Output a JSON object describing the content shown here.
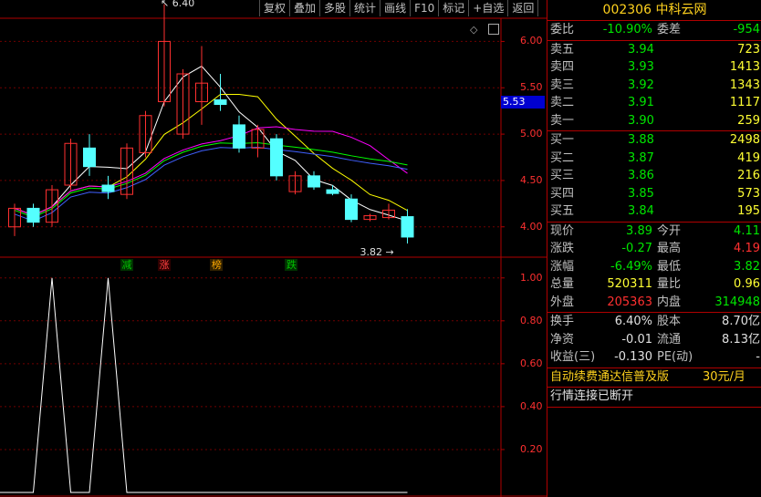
{
  "toolbar": [
    "复权",
    "叠加",
    "多股",
    "统计",
    "画线",
    "F10",
    "标记",
    "+自选",
    "返回"
  ],
  "stock": {
    "code": "002306",
    "name": "中科云网"
  },
  "price_tag": "5.53",
  "price_axis": [
    "6.00",
    "5.50",
    "5.00",
    "4.50",
    "4.00"
  ],
  "indicator_axis": [
    "1.00",
    "0.80",
    "0.60",
    "0.40",
    "0.20"
  ],
  "annotations": {
    "high": "6.40",
    "low": "3.82"
  },
  "markers": [
    {
      "text": "减",
      "color": "#00c000",
      "bg": "#003000"
    },
    {
      "text": "涨",
      "color": "#ff4040",
      "bg": "#300000"
    },
    {
      "text": "榜",
      "color": "#ffaa00",
      "bg": "#302000"
    },
    {
      "text": "跌",
      "color": "#00c000",
      "bg": "#003000"
    }
  ],
  "order_book": {
    "weibi": {
      "label": "委比",
      "value": "-10.90%",
      "label2": "委差",
      "value2": "-954"
    },
    "sell": [
      {
        "label": "卖五",
        "price": "3.94",
        "vol": "723"
      },
      {
        "label": "卖四",
        "price": "3.93",
        "vol": "1413"
      },
      {
        "label": "卖三",
        "price": "3.92",
        "vol": "1343"
      },
      {
        "label": "卖二",
        "price": "3.91",
        "vol": "1117"
      },
      {
        "label": "卖一",
        "price": "3.90",
        "vol": "259"
      }
    ],
    "buy": [
      {
        "label": "买一",
        "price": "3.88",
        "vol": "2498"
      },
      {
        "label": "买二",
        "price": "3.87",
        "vol": "419"
      },
      {
        "label": "买三",
        "price": "3.86",
        "vol": "216"
      },
      {
        "label": "买四",
        "price": "3.85",
        "vol": "573"
      },
      {
        "label": "买五",
        "price": "3.84",
        "vol": "195"
      }
    ]
  },
  "quote": [
    {
      "l1": "现价",
      "v1": "3.89",
      "l2": "今开",
      "v2": "4.11"
    },
    {
      "l1": "涨跌",
      "v1": "-0.27",
      "l2": "最高",
      "v2": "4.19"
    },
    {
      "l1": "涨幅",
      "v1": "-6.49%",
      "l2": "最低",
      "v2": "3.82"
    },
    {
      "l1": "总量",
      "v1": "520311",
      "l2": "量比",
      "v2": "0.96"
    },
    {
      "l1": "外盘",
      "v1": "205363",
      "l2": "内盘",
      "v2": "314948"
    }
  ],
  "fundamentals": [
    {
      "l1": "换手",
      "v1": "6.40%",
      "l2": "股本",
      "v2": "8.70亿"
    },
    {
      "l1": "净资",
      "v1": "-0.01",
      "l2": "流通",
      "v2": "8.13亿"
    },
    {
      "l1": "收益(三)",
      "v1": "-0.130",
      "l2": "PE(动)",
      "v2": "-"
    }
  ],
  "promo": {
    "text": "自动续费通达信普及版",
    "price": "30元/月"
  },
  "status": "行情连接已断开",
  "chart_data": {
    "type": "candlestick",
    "candles": [
      {
        "o": 4.0,
        "c": 4.2,
        "h": 4.25,
        "l": 3.9
      },
      {
        "o": 4.2,
        "c": 4.05,
        "h": 4.25,
        "l": 4.0
      },
      {
        "o": 4.05,
        "c": 4.4,
        "h": 4.45,
        "l": 4.0
      },
      {
        "o": 4.45,
        "c": 4.9,
        "h": 4.95,
        "l": 4.4
      },
      {
        "o": 4.85,
        "c": 4.65,
        "h": 5.0,
        "l": 4.55
      },
      {
        "o": 4.45,
        "c": 4.38,
        "h": 4.55,
        "l": 4.3
      },
      {
        "o": 4.35,
        "c": 4.85,
        "h": 4.9,
        "l": 4.3
      },
      {
        "o": 4.8,
        "c": 5.2,
        "h": 5.25,
        "l": 4.75
      },
      {
        "o": 5.35,
        "c": 6.0,
        "h": 6.4,
        "l": 5.3
      },
      {
        "o": 5.0,
        "c": 5.65,
        "h": 5.7,
        "l": 4.95
      },
      {
        "o": 5.35,
        "c": 5.55,
        "h": 5.95,
        "l": 5.1
      },
      {
        "o": 5.37,
        "c": 5.32,
        "h": 5.65,
        "l": 5.25
      },
      {
        "o": 5.1,
        "c": 4.85,
        "h": 5.2,
        "l": 4.8
      },
      {
        "o": 4.85,
        "c": 5.05,
        "h": 5.1,
        "l": 4.75
      },
      {
        "o": 4.95,
        "c": 4.55,
        "h": 5.0,
        "l": 4.5
      },
      {
        "o": 4.38,
        "c": 4.55,
        "h": 4.6,
        "l": 4.35
      },
      {
        "o": 4.55,
        "c": 4.43,
        "h": 4.6,
        "l": 4.4
      },
      {
        "o": 4.4,
        "c": 4.36,
        "h": 4.45,
        "l": 4.34
      },
      {
        "o": 4.3,
        "c": 4.08,
        "h": 4.35,
        "l": 4.05
      },
      {
        "o": 4.08,
        "c": 4.12,
        "h": 4.14,
        "l": 4.06
      },
      {
        "o": 4.1,
        "c": 4.18,
        "h": 4.25,
        "l": 4.08
      },
      {
        "o": 4.11,
        "c": 3.89,
        "h": 4.19,
        "l": 3.82
      }
    ],
    "ylim": [
      3.9,
      6.0
    ],
    "indicator": [
      0,
      0,
      1,
      0,
      0,
      1,
      0,
      0,
      0,
      0,
      0,
      0,
      0,
      0,
      0,
      0,
      0,
      0,
      0,
      0,
      0,
      0
    ],
    "indicator_ylim": [
      0,
      1.0
    ],
    "colors": {
      "up": "#ff3030",
      "down": "#54ffff",
      "ma1": "#ffffff",
      "ma2": "#ffff00",
      "ma3": "#ff00ff",
      "ma4": "#00ff00",
      "ma5": "#4060ff"
    }
  }
}
